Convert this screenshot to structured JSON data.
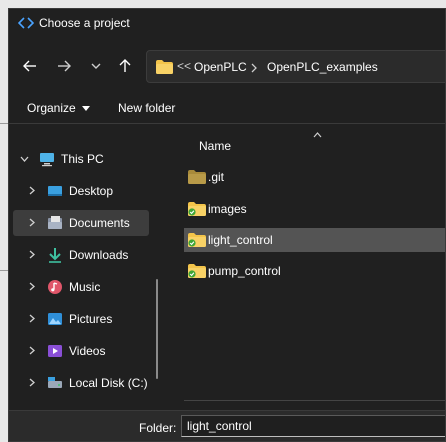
{
  "window": {
    "title": "Choose a project"
  },
  "address": {
    "overflow": "<<",
    "crumbs": [
      "OpenPLC",
      "OpenPLC_examples"
    ]
  },
  "toolbar": {
    "organize_label": "Organize",
    "new_folder_label": "New folder"
  },
  "nav": {
    "items": [
      {
        "label": "This PC",
        "icon": "computer-icon"
      },
      {
        "label": "Desktop",
        "icon": "desktop-icon"
      },
      {
        "label": "Documents",
        "icon": "documents-icon",
        "selected": true
      },
      {
        "label": "Downloads",
        "icon": "downloads-icon"
      },
      {
        "label": "Music",
        "icon": "music-icon"
      },
      {
        "label": "Pictures",
        "icon": "pictures-icon"
      },
      {
        "label": "Videos",
        "icon": "videos-icon"
      },
      {
        "label": "Local Disk (C:)",
        "icon": "disk-icon"
      }
    ]
  },
  "content": {
    "column_name": "Name",
    "files": [
      {
        "name": ".git",
        "icon": "folder-icon"
      },
      {
        "name": "images",
        "icon": "folder-synced-icon"
      },
      {
        "name": "light_control",
        "icon": "folder-synced-icon",
        "selected": true
      },
      {
        "name": "pump_control",
        "icon": "folder-synced-icon"
      }
    ]
  },
  "footer": {
    "folder_label": "Folder:",
    "folder_value": "light_control"
  },
  "colors": {
    "background": "#202020",
    "selection": "#545454",
    "folder": "#f3c44a",
    "sync_badge": "#3fa535"
  }
}
